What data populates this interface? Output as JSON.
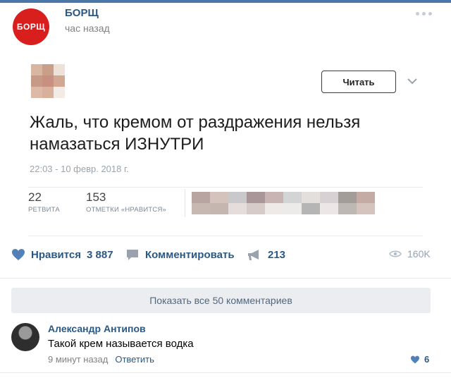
{
  "post": {
    "group_name": "БОРЩ",
    "group_logo_text": "БОРЩ",
    "time": "час назад",
    "more_icon": "more-dots-icon"
  },
  "tweet": {
    "follow_label": "Читать",
    "text": "Жаль, что кремом от раздражения нельзя намазаться ИЗНУТРИ",
    "date": "22:03 - 10 февр. 2018 г.",
    "retweets": {
      "count": "22",
      "label": "РЕТВИТА"
    },
    "likes": {
      "count": "153",
      "label": "ОТМЕТКИ «НРАВИТСЯ»"
    }
  },
  "actions": {
    "like_label": "Нравится",
    "like_count": "3 887",
    "comment_label": "Комментировать",
    "repost_count": "213",
    "views": "160K"
  },
  "comments": {
    "show_all_label": "Показать все 50 комментариев",
    "items": [
      {
        "author": "Александр Антипов",
        "text": "Такой крем называется водка",
        "time": "9 минут назад",
        "reply_label": "Ответить",
        "likes": "6"
      }
    ]
  },
  "colors": {
    "accent": "#2a5885",
    "brand_red": "#d91e1e",
    "top_bar": "#4a76a8"
  }
}
